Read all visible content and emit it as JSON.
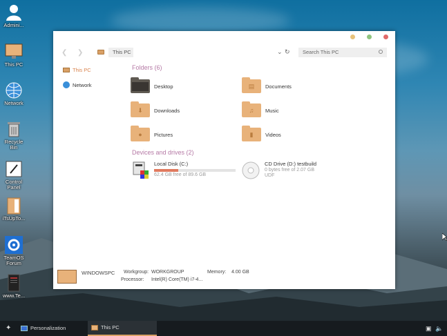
{
  "desktop": {
    "icons": [
      {
        "label": "Admini..."
      },
      {
        "label": "This PC"
      },
      {
        "label": "Network"
      },
      {
        "label": "Recycle Bin"
      },
      {
        "label": "Control Panel"
      },
      {
        "label": "iTsUpTo..."
      },
      {
        "label": "TeamOS Forum"
      },
      {
        "label": "www.Te..."
      }
    ]
  },
  "window": {
    "address": "This PC",
    "search_placeholder": "Search This PC",
    "sidebar": [
      {
        "label": "This PC",
        "icon": "folder-icon",
        "active": true
      },
      {
        "label": "Network",
        "icon": "globe-icon",
        "active": false
      }
    ],
    "folders_title": "Folders (6)",
    "folders": [
      {
        "label": "Desktop",
        "icon": "desktop-folder-icon"
      },
      {
        "label": "Documents",
        "icon": "documents-folder-icon"
      },
      {
        "label": "Downloads",
        "icon": "downloads-folder-icon"
      },
      {
        "label": "Music",
        "icon": "music-folder-icon"
      },
      {
        "label": "Pictures",
        "icon": "pictures-folder-icon"
      },
      {
        "label": "Videos",
        "icon": "videos-folder-icon"
      }
    ],
    "drives_title": "Devices and drives (2)",
    "drives": [
      {
        "label": "Local Disk (C:)",
        "free": "62.4 GB free of 89.6 GB",
        "used_fraction": 0.3
      },
      {
        "label": "CD Drive (D:) testbuild",
        "free": "0 bytes free of 2.07 GB",
        "fs": "UDF"
      }
    ],
    "details": {
      "computer": "WINDOWSPC",
      "workgroup_label": "Workgroup:",
      "workgroup": "WORKGROUP",
      "memory_label": "Memory:",
      "memory": "4.00 GB",
      "processor_label": "Processor:",
      "processor": "Intel(R) Core(TM) i7-4..."
    },
    "dot_colors": [
      "#e8c27a",
      "#8fc47f",
      "#e06a6a"
    ]
  },
  "taskbar": {
    "tasks": [
      {
        "label": "Personalization",
        "active": false
      },
      {
        "label": "This PC",
        "active": true
      }
    ]
  }
}
